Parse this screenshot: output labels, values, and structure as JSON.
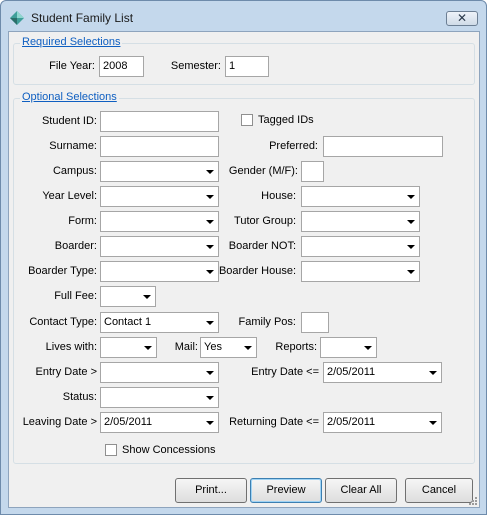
{
  "window": {
    "title": "Student Family List",
    "close_glyph": "✕"
  },
  "required": {
    "group_label": "Required Selections",
    "file_year_label": "File Year:",
    "file_year_value": "2008",
    "semester_label": "Semester:",
    "semester_value": "1"
  },
  "optional": {
    "group_label": "Optional Selections",
    "student_id_label": "Student ID:",
    "student_id_value": "",
    "tagged_ids_label": "Tagged IDs",
    "surname_label": "Surname:",
    "surname_value": "",
    "preferred_label": "Preferred:",
    "preferred_value": "",
    "campus_label": "Campus:",
    "campus_value": "",
    "gender_label": "Gender (M/F):",
    "gender_value": "",
    "year_level_label": "Year Level:",
    "year_level_value": "",
    "house_label": "House:",
    "house_value": "",
    "form_label": "Form:",
    "form_value": "",
    "tutor_group_label": "Tutor Group:",
    "tutor_group_value": "",
    "boarder_label": "Boarder:",
    "boarder_value": "",
    "boarder_not_label": "Boarder NOT:",
    "boarder_not_value": "",
    "boarder_type_label": "Boarder Type:",
    "boarder_type_value": "",
    "boarder_house_label": "Boarder House:",
    "boarder_house_value": "",
    "full_fee_label": "Full Fee:",
    "full_fee_value": "",
    "contact_type_label": "Contact Type:",
    "contact_type_value": "Contact 1",
    "family_pos_label": "Family Pos:",
    "family_pos_value": "",
    "lives_with_label": "Lives with:",
    "lives_with_value": "",
    "mail_label": "Mail:",
    "mail_value": "Yes",
    "reports_label": "Reports:",
    "reports_value": "",
    "entry_date_gt_label": "Entry Date >",
    "entry_date_gt_value": "",
    "entry_date_le_label": "Entry Date <=",
    "entry_date_le_value": "2/05/2011",
    "status_label": "Status:",
    "status_value": "",
    "leaving_date_label": "Leaving Date >",
    "leaving_date_value": "2/05/2011",
    "returning_date_label": "Returning Date <=",
    "returning_date_value": "2/05/2011",
    "show_concessions_label": "Show Concessions"
  },
  "buttons": {
    "print": "Print...",
    "preview": "Preview",
    "clear_all": "Clear All",
    "cancel": "Cancel"
  }
}
